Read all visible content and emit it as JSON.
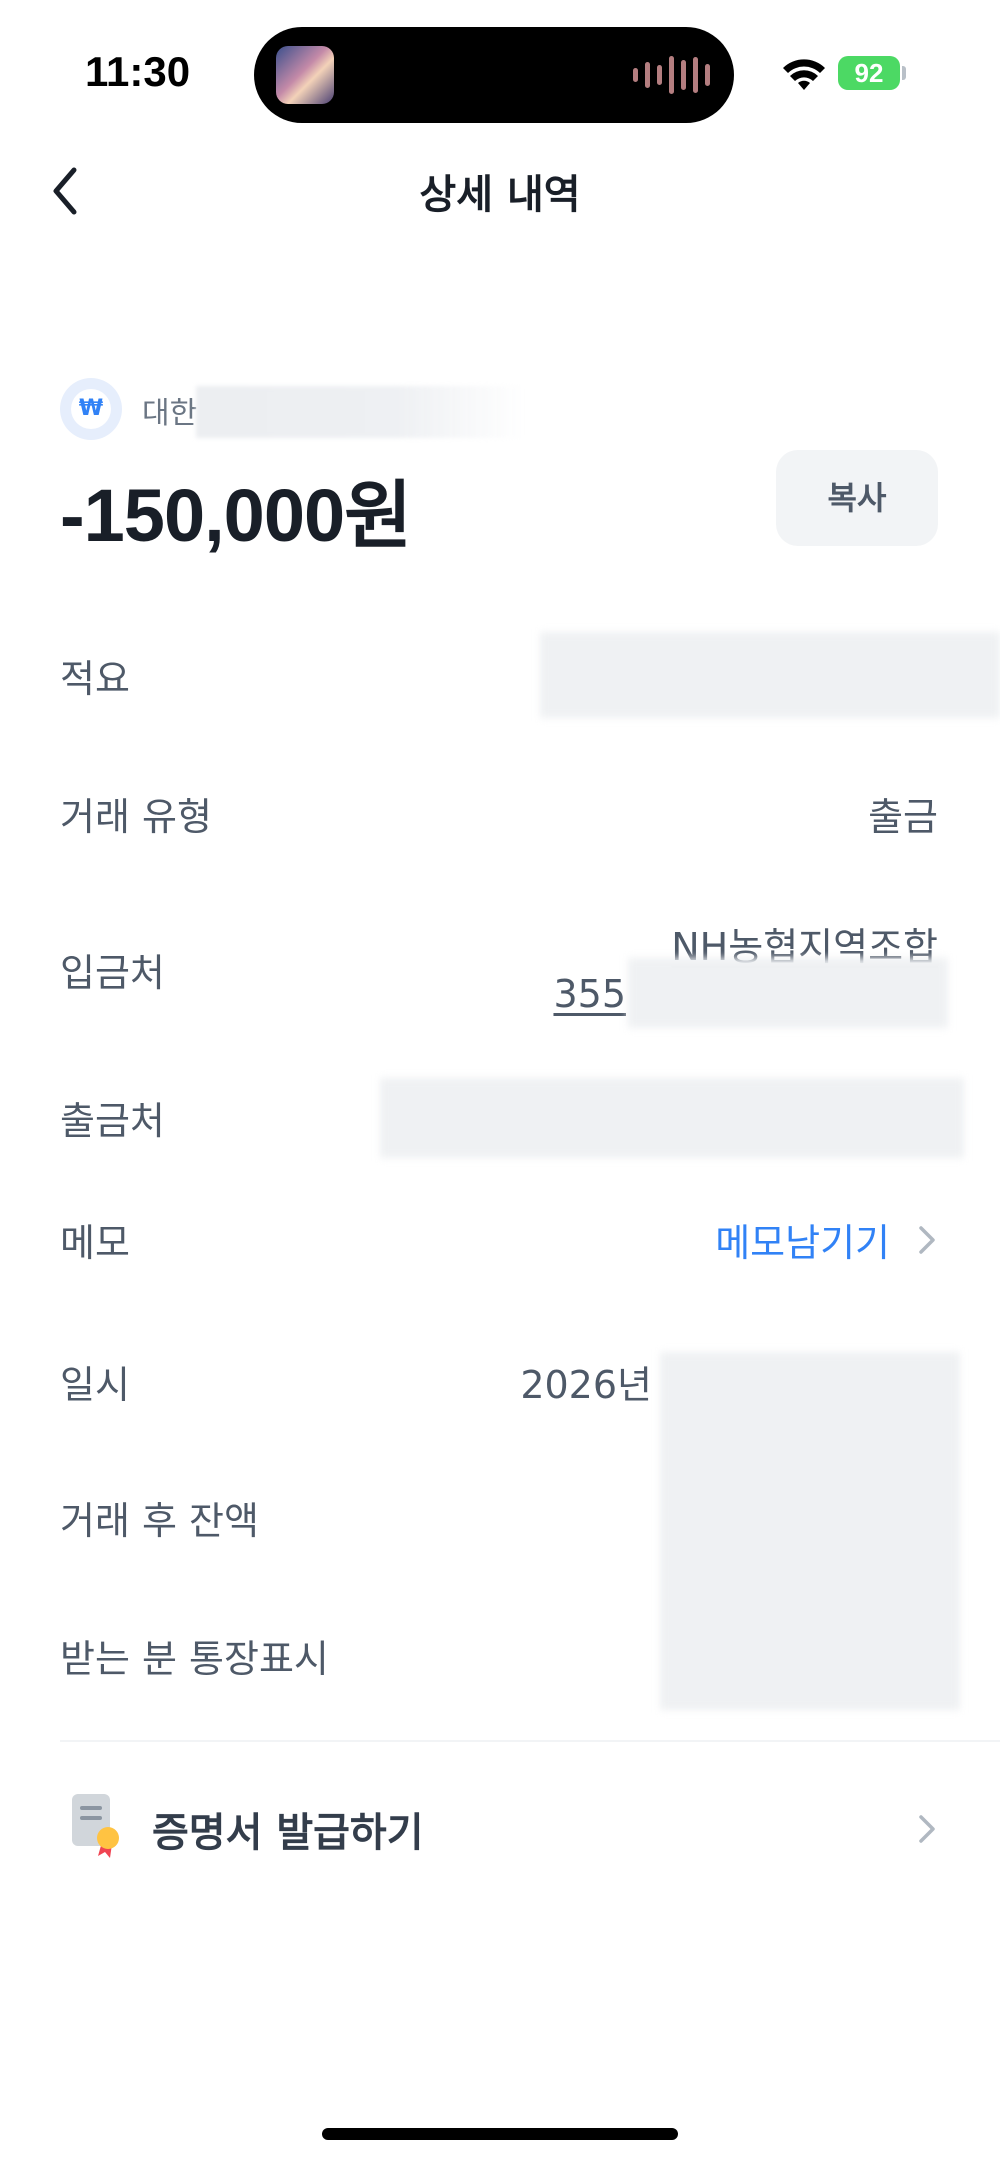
{
  "status_bar": {
    "time": "11:30",
    "battery": "92"
  },
  "header": {
    "title": "상세 내역",
    "back_icon": "chevron-left-icon"
  },
  "transaction": {
    "bank_name": "대한",
    "bank_logo_glyph": "₩",
    "amount": "-150,000원",
    "copy_label": "복사"
  },
  "details": {
    "summary_label": "적요",
    "type_label": "거래 유형",
    "type_value": "출금",
    "deposit_to_label": "입금처",
    "deposit_to_bank": "NH농협지역조합",
    "deposit_to_account": "355",
    "withdraw_from_label": "출금처",
    "memo_label": "메모",
    "memo_action": "메모남기기",
    "datetime_label": "일시",
    "datetime_value": "2026년",
    "balance_label": "거래 후 잔액",
    "recipient_display_label": "받는 분 통장표시"
  },
  "certificate": {
    "label": "증명서 발급하기",
    "icon": "certificate-icon"
  },
  "colors": {
    "accent": "#3182f6",
    "text_primary": "#191f28",
    "text_secondary": "#4e5968",
    "battery": "#4cd964"
  }
}
